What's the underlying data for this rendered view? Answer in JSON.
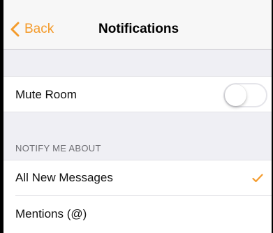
{
  "nav": {
    "back_label": "Back",
    "title": "Notifications",
    "accent_color": "#f49b2b"
  },
  "settings": {
    "mute_room": {
      "label": "Mute Room",
      "toggle_on": false
    }
  },
  "notify_section": {
    "header": "NOTIFY ME ABOUT",
    "options": [
      {
        "label": "All New Messages",
        "selected": true
      },
      {
        "label": "Mentions (@)",
        "selected": false
      }
    ]
  },
  "icons": {
    "back": "chevron-left-icon",
    "selected": "checkmark-icon"
  }
}
